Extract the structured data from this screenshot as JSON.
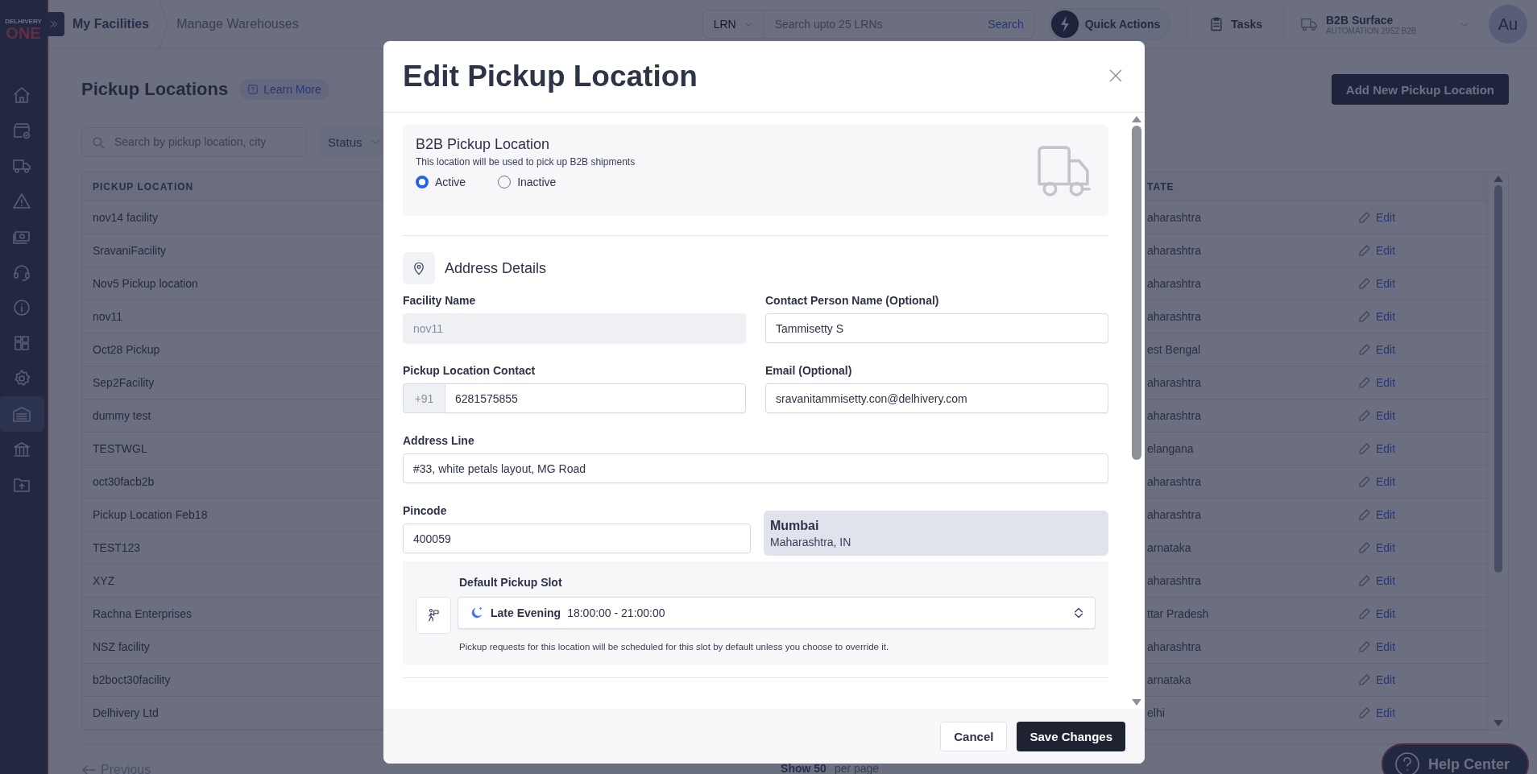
{
  "sidebar": {
    "logo": {
      "line_1": "DELHIVERY",
      "line_2": "ONE"
    },
    "items": [
      {
        "selected": false
      },
      {
        "selected": false
      },
      {
        "selected": false
      },
      {
        "selected": false
      },
      {
        "selected": false
      },
      {
        "selected": false
      },
      {
        "selected": false
      },
      {
        "selected": false
      },
      {
        "selected": false
      },
      {
        "selected": true
      },
      {
        "selected": false
      },
      {
        "selected": false
      }
    ]
  },
  "topbar": {
    "breadcrumbs": [
      "My Facilities",
      "Manage Warehouses"
    ],
    "lrn_select": "LRN",
    "search": {
      "placeholder": "Search upto 25 LRNs"
    },
    "search_button": "Search",
    "quick_actions": "Quick Actions",
    "tasks": "Tasks",
    "account": {
      "name": "B2B Surface",
      "subtitle": "AUTOMATION 2952 B2B"
    },
    "avatar": "Au"
  },
  "page": {
    "title": "Pickup Locations",
    "learn_more": "Learn More",
    "add_button": "Add New Pickup Location",
    "search": {
      "placeholder": "Search by pickup location, city"
    },
    "status_filter": "Status",
    "table": {
      "columns": [
        "PICKUP LOCATION",
        "TATE"
      ],
      "rows": [
        {
          "name": "nov14 facility",
          "state": "aharashtra",
          "action": "Edit"
        },
        {
          "name": "SravaniFacility",
          "state": "aharashtra",
          "action": "Edit"
        },
        {
          "name": "Nov5 Pickup location",
          "state": "aharashtra",
          "action": "Edit"
        },
        {
          "name": "nov11",
          "state": "aharashtra",
          "action": "Edit"
        },
        {
          "name": "Oct28 Pickup",
          "state": "est Bengal",
          "action": "Edit"
        },
        {
          "name": "Sep2Facility",
          "state": "aharashtra",
          "action": "Edit"
        },
        {
          "name": "dummy test",
          "state": "aharashtra",
          "action": "Edit"
        },
        {
          "name": "TESTWGL",
          "state": "elangana",
          "action": "Edit"
        },
        {
          "name": "oct30facb2b",
          "state": "aharashtra",
          "action": "Edit"
        },
        {
          "name": "Pickup Location Feb18",
          "state": "aharashtra",
          "action": "Edit"
        },
        {
          "name": "TEST123",
          "state": "arnataka",
          "action": "Edit"
        },
        {
          "name": "XYZ",
          "state": "aharashtra",
          "action": "Edit"
        },
        {
          "name": "Rachna Enterprises",
          "state": "ttar Pradesh",
          "action": "Edit"
        },
        {
          "name": "NSZ facility",
          "state": "aharashtra",
          "action": "Edit"
        },
        {
          "name": "b2boct30facility",
          "state": "arnataka",
          "action": "Edit"
        },
        {
          "name": "Delhivery Ltd",
          "state": "elhi",
          "action": "Edit"
        }
      ]
    },
    "pagination": {
      "previous": "Previous",
      "show": "Show 50",
      "per_page": "per page"
    },
    "help_center": "Help Center"
  },
  "modal": {
    "title": "Edit Pickup Location",
    "b2b": {
      "title": "B2B Pickup Location",
      "description": "This location will be used to pick up B2B shipments",
      "options": [
        {
          "label": "Active",
          "selected": true
        },
        {
          "label": "Inactive",
          "selected": false
        }
      ]
    },
    "section_title": "Address Details",
    "facility_name": {
      "label": "Facility Name",
      "value": "nov11",
      "disabled": true
    },
    "contact_person": {
      "label": "Contact Person Name (Optional)",
      "value": "Tammisetty S",
      "disabled": false
    },
    "pickup_contact": {
      "label": "Pickup Location Contact",
      "prefix": "+91",
      "value": "6281575855",
      "disabled": false
    },
    "email": {
      "label": "Email (Optional)",
      "value": "sravanitammisetty.con@delhivery.com",
      "disabled": false
    },
    "address_line": {
      "label": "Address Line",
      "value": "#33, white petals layout, MG Road",
      "disabled": false
    },
    "pincode": {
      "label": "Pincode",
      "value": "400059",
      "disabled": false
    },
    "location": {
      "city": "Mumbai",
      "region": "Maharashtra, IN"
    },
    "pickup_slot": {
      "label": "Default Pickup Slot",
      "slot_name": "Late Evening",
      "slot_time": "18:00:00 - 21:00:00",
      "hint": "Pickup requests for this location will be scheduled for this slot by default unless you choose to override it."
    },
    "buttons": {
      "cancel": "Cancel",
      "save": "Save Changes"
    }
  }
}
